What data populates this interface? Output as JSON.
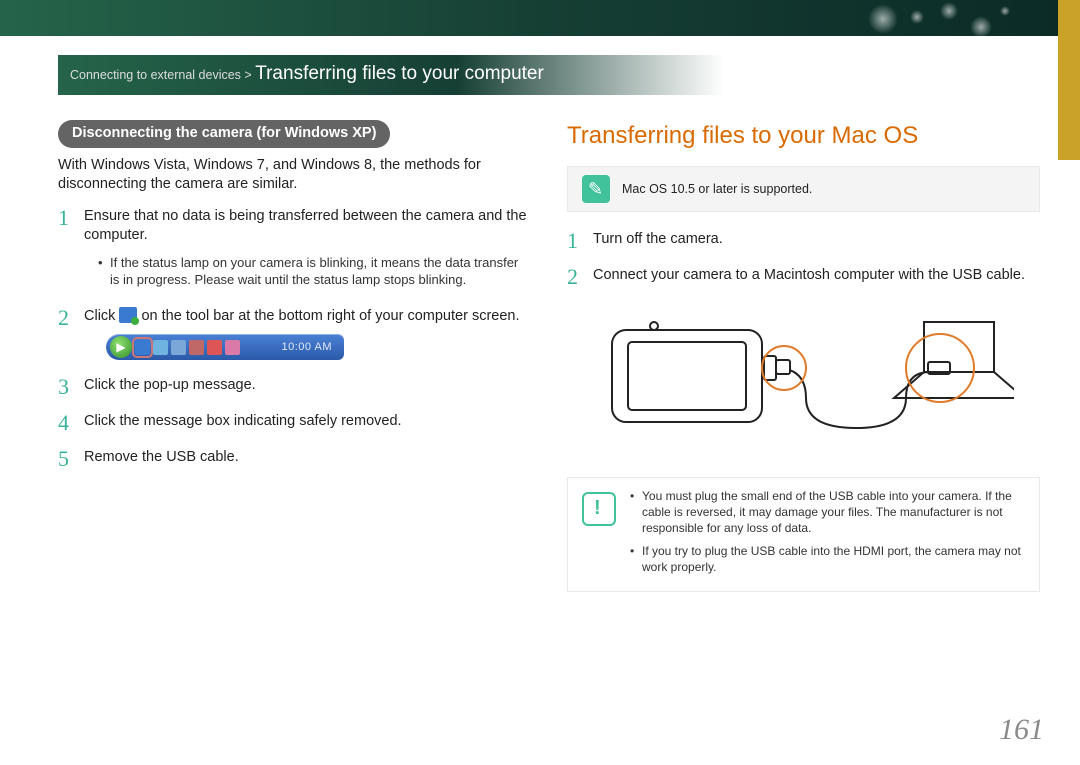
{
  "breadcrumb": {
    "section": "Connecting to external devices >",
    "title": "Transferring files to your computer"
  },
  "left": {
    "pill": "Disconnecting the camera (for Windows XP)",
    "intro": "With Windows Vista, Windows 7, and Windows 8, the methods for disconnecting the camera are similar.",
    "steps": [
      {
        "n": "1",
        "text": "Ensure that no data is being transferred between the camera and the computer.",
        "sub": [
          "If the status lamp on your camera is blinking, it means the data transfer is in progress. Please wait until the status lamp stops blinking."
        ]
      },
      {
        "n": "2",
        "pre": "Click ",
        "post": " on the tool bar at the bottom right of your computer screen."
      },
      {
        "n": "3",
        "text": "Click the pop-up message."
      },
      {
        "n": "4",
        "text": "Click the message box indicating safely removed."
      },
      {
        "n": "5",
        "text": "Remove the USB cable."
      }
    ],
    "taskbar_time": "10:00 AM"
  },
  "right": {
    "heading": "Transferring files to your Mac OS",
    "note": "Mac OS 10.5 or later is supported.",
    "steps": [
      {
        "n": "1",
        "text": "Turn off the camera."
      },
      {
        "n": "2",
        "text": "Connect your camera to a Macintosh computer with the USB cable."
      }
    ],
    "warn": [
      "You must plug the small end of the USB cable into your camera. If the cable is reversed, it may damage your files. The manufacturer is not responsible for any loss of data.",
      "If you try to plug the USB cable into the HDMI port, the camera may not work properly."
    ]
  },
  "page_number": "161"
}
